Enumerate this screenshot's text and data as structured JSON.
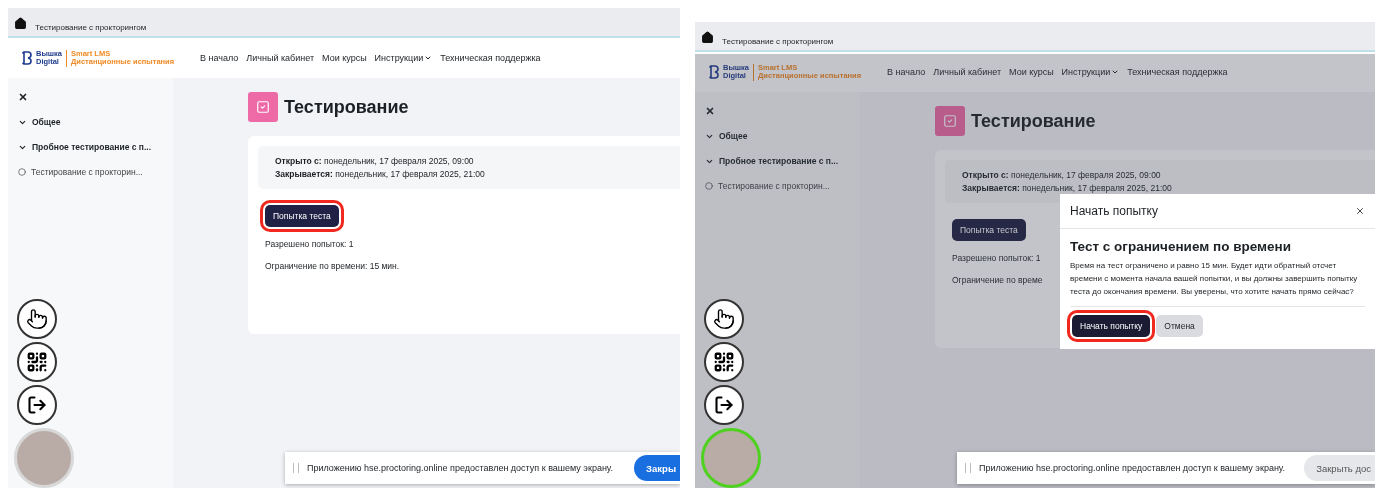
{
  "panels": [
    {
      "breadcrumb": {
        "title": "Тестирование с прокторингом"
      },
      "logo": {
        "line1": "Вышка",
        "line2": "Digital",
        "brand1": "Smart LMS",
        "brand2": "Дистанционные испытания"
      },
      "nav": [
        {
          "label": "В начало",
          "dropdown": false
        },
        {
          "label": "Личный кабинет",
          "dropdown": false
        },
        {
          "label": "Мои курсы",
          "dropdown": false
        },
        {
          "label": "Инструкции",
          "dropdown": true
        },
        {
          "label": "Техническая поддержка",
          "dropdown": false
        }
      ],
      "sidebar": [
        {
          "label": "Общее",
          "kind": "section"
        },
        {
          "label": "Пробное тестирование с п...",
          "kind": "section"
        },
        {
          "label": "Тестирование с прокторин...",
          "kind": "activity"
        }
      ],
      "page_title": "Тестирование",
      "dates": [
        "**Открыто с:** понедельник, 17 февраля 2025, 09:00",
        "**Закрывается:** понедельник, 17 февраля 2025, 21:00"
      ],
      "attempt_button": {
        "label": "Попытка теста",
        "highlighted": true
      },
      "info": [
        "Разрешено попыток: 1",
        "Ограничение по времени: 15 мин."
      ],
      "camera_ok": false,
      "toast": {
        "text": "Приложению hse.proctoring.online предоставлен доступ к вашему экрану.",
        "button": {
          "label": "Закры",
          "kind": "primary"
        }
      }
    },
    {
      "breadcrumb": {
        "title": "Тестирование с прокторингом"
      },
      "logo": {
        "line1": "Вышка",
        "line2": "Digital",
        "brand1": "Smart LMS",
        "brand2": "Дистанционные испытания"
      },
      "nav": [
        {
          "label": "В начало",
          "dropdown": false
        },
        {
          "label": "Личный кабинет",
          "dropdown": false
        },
        {
          "label": "Мои курсы",
          "dropdown": false
        },
        {
          "label": "Инструкции",
          "dropdown": true
        },
        {
          "label": "Техническая поддержка",
          "dropdown": false
        }
      ],
      "sidebar": [
        {
          "label": "Общее",
          "kind": "section"
        },
        {
          "label": "Пробное тестирование с п...",
          "kind": "section"
        },
        {
          "label": "Тестирование с прокторин...",
          "kind": "activity"
        }
      ],
      "page_title": "Тестирование",
      "dates": [
        "**Открыто с:** понедельник, 17 февраля 2025, 09:00",
        "**Закрывается:** понедельник, 17 февраля 2025, 21:00"
      ],
      "attempt_button": {
        "label": "Попытка теста",
        "highlighted": false
      },
      "info": [
        "Разрешено попыток: 1",
        "Ограничение по време"
      ],
      "camera_ok": true,
      "toast": {
        "text": "Приложению hse.proctoring.online предоставлен доступ к вашему экрану.",
        "button": {
          "label": "Закрыть дос",
          "kind": "secondary"
        }
      },
      "dialog": {
        "title": "Начать попытку",
        "heading": "Тест с ограничением по времени",
        "text": "Время на тест ограничено и равно 15 мин. Будет идти обратный отсчет времени с момента начала вашей попытки, и вы должны завершить попытку теста до окончания времени. Вы уверены, что хотите начать прямо сейчас?",
        "buttons": [
          {
            "label": "Начать попытку",
            "kind": "primary",
            "highlighted": true
          },
          {
            "label": "Отмена",
            "kind": "secondary",
            "highlighted": false
          }
        ]
      }
    }
  ]
}
